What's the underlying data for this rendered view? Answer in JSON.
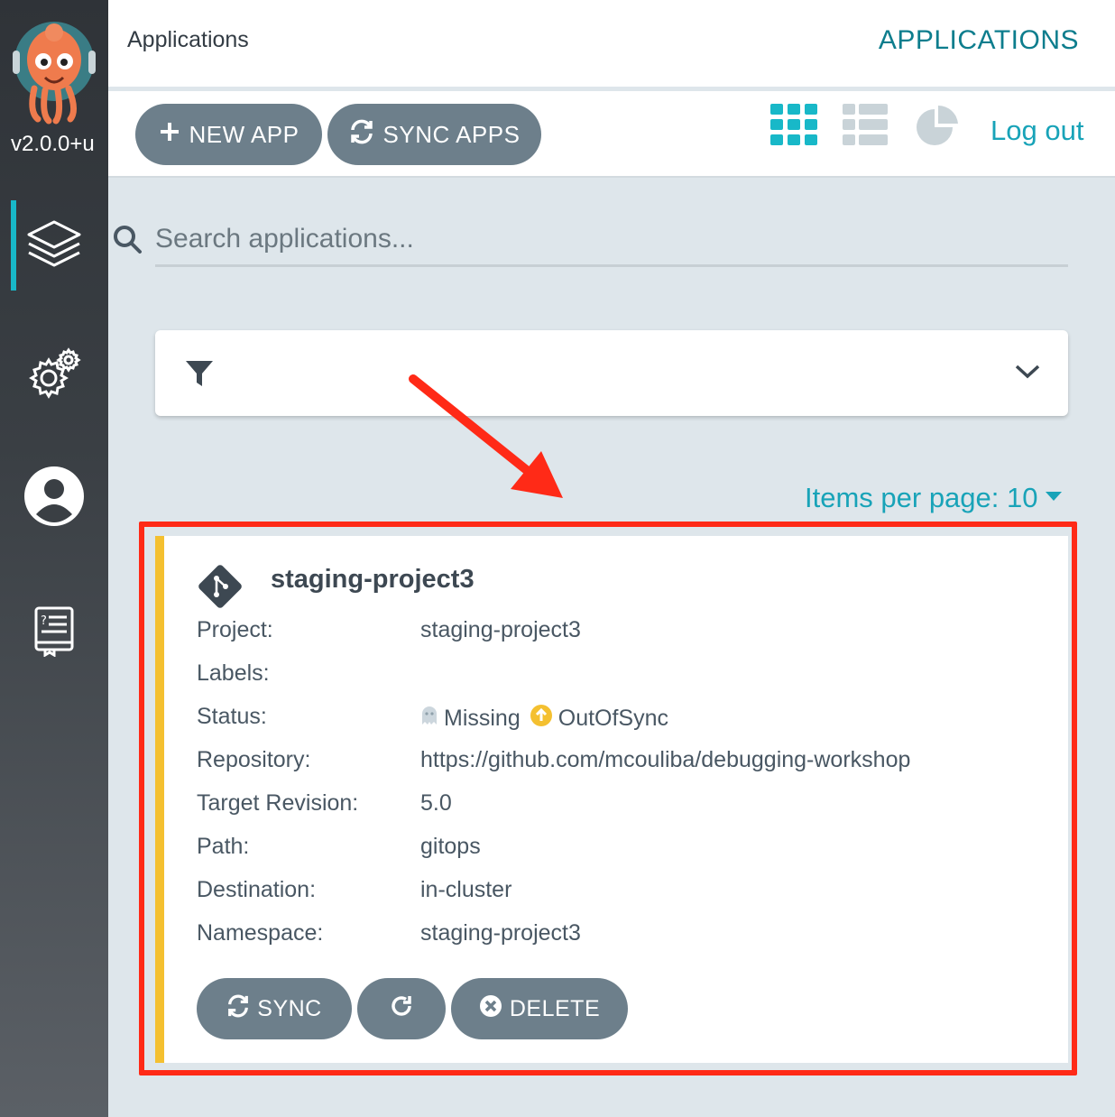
{
  "sidebar": {
    "version": "v2.0.0+u",
    "items": [
      {
        "name": "applications",
        "icon": "layers-icon",
        "active": true
      },
      {
        "name": "settings",
        "icon": "gears-icon",
        "active": false
      },
      {
        "name": "user-info",
        "icon": "user-circle-icon",
        "active": false
      },
      {
        "name": "documentation",
        "icon": "book-icon",
        "active": false
      }
    ]
  },
  "header": {
    "breadcrumb": "Applications",
    "title": "APPLICATIONS"
  },
  "toolbar": {
    "new_app": "NEW APP",
    "sync_apps": "SYNC APPS",
    "views": [
      "tiles-view-icon",
      "list-view-icon",
      "summary-pie-icon"
    ],
    "logout": "Log out"
  },
  "search": {
    "placeholder": "Search applications...",
    "value": ""
  },
  "pagination": {
    "items_per_page": "Items per page: 10"
  },
  "app": {
    "name": "staging-project3",
    "fields": {
      "project_label": "Project:",
      "project": "staging-project3",
      "labels_label": "Labels:",
      "labels": "",
      "status_label": "Status:",
      "health": "Missing",
      "sync": "OutOfSync",
      "repo_label": "Repository:",
      "repo": "https://github.com/mcouliba/debugging-workshop",
      "revision_label": "Target Revision:",
      "revision": "5.0",
      "path_label": "Path:",
      "path": "gitops",
      "dest_label": "Destination:",
      "destination": "in-cluster",
      "ns_label": "Namespace:",
      "namespace": "staging-project3"
    },
    "actions": {
      "sync": "SYNC",
      "delete": "DELETE"
    },
    "status_color": "#f4c030"
  },
  "colors": {
    "accent": "#18a3b8",
    "button": "#6d7f8b",
    "highlight": "#ff2a17"
  }
}
